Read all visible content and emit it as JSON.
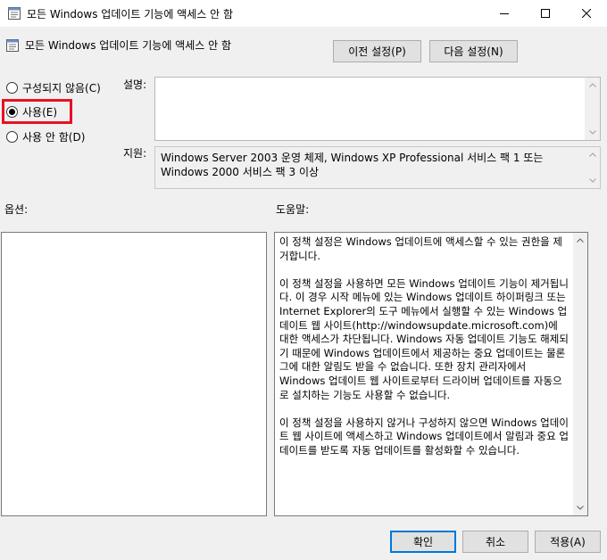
{
  "window": {
    "title": "모든 Windows 업데이트 기능에 액세스 안 함"
  },
  "header": {
    "title": "모든 Windows 업데이트 기능에 액세스 안 함",
    "prev_label": "이전 설정(P)",
    "next_label": "다음 설정(N)"
  },
  "state": {
    "options": [
      {
        "label": "구성되지 않음(C)",
        "checked": false
      },
      {
        "label": "사용(E)",
        "checked": true
      },
      {
        "label": "사용 안 함(D)",
        "checked": false
      }
    ],
    "highlight_color": "#e81123"
  },
  "comment": {
    "label": "설명:",
    "value": ""
  },
  "supported": {
    "label": "지원:",
    "text": "Windows Server 2003 운영 체제, Windows XP Professional 서비스 팩 1 또는 Windows 2000 서비스 팩 3 이상"
  },
  "options_section": {
    "label": "옵션:"
  },
  "help_section": {
    "label": "도움말:",
    "paragraphs": [
      "이 정책 설정은 Windows 업데이트에 액세스할 수 있는 권한을 제거합니다.",
      "이 정책 설정을 사용하면 모든 Windows 업데이트 기능이 제거됩니다. 이 경우 시작 메뉴에 있는 Windows 업데이트 하이퍼링크 또는 Internet Explorer의 도구 메뉴에서 실행할 수 있는 Windows 업데이트 웹 사이트(http://windowsupdate.microsoft.com)에 대한 액세스가 차단됩니다. Windows 자동 업데이트 기능도 해제되기 때문에 Windows 업데이트에서 제공하는 중요 업데이트는 물론 그에 대한 알림도 받을 수 없습니다. 또한 장치 관리자에서 Windows 업데이트 웹 사이트로부터 드라이버 업데이트를 자동으로 설치하는 기능도 사용할 수 없습니다.",
      "이 정책 설정을 사용하지 않거나 구성하지 않으면 Windows 업데이트 웹 사이트에 액세스하고 Windows 업데이트에서 알림과 중요 업데이트를 받도록 자동 업데이트를 활성화할 수 있습니다."
    ]
  },
  "footer": {
    "ok_label": "확인",
    "cancel_label": "취소",
    "apply_label": "적용(A)"
  },
  "icons": {
    "app": "policy-setting-icon",
    "minimize": "minimize-icon",
    "maximize": "maximize-icon",
    "close": "close-icon"
  }
}
